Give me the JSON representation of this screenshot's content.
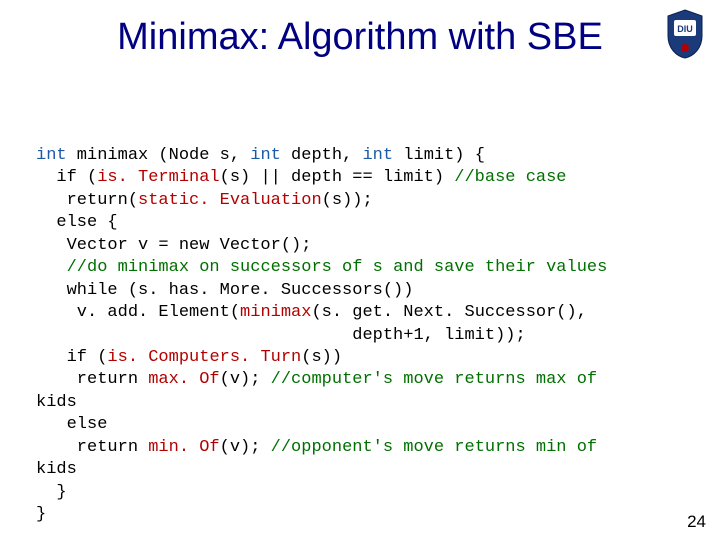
{
  "title": "Minimax: Algorithm with SBE",
  "logo": {
    "name": "diu-crest"
  },
  "code": {
    "l1a": "int",
    "l1b": " minimax (Node s, ",
    "l1c": "int",
    "l1d": " depth, ",
    "l1e": "int",
    "l1f": " limit) {",
    "l2a": "  if (",
    "l2b": "is. Terminal",
    "l2c": "(s) || depth == limit) ",
    "l2d": "//base case",
    "l3a": "   return(",
    "l3b": "static. Evaluation",
    "l3c": "(s));",
    "l4": "  else {",
    "l5": "   Vector v = new Vector();",
    "l6": "   ",
    "l6b": "//do minimax on successors of s and save their values",
    "l7": "   while (s. has. More. Successors())",
    "l8a": "    v. add. Element(",
    "l8b": "minimax",
    "l8c": "(s. get. Next. Successor(),",
    "l9": "                               depth+1, limit));",
    "l10a": "   if (",
    "l10b": "is. Computers. Turn",
    "l10c": "(s))",
    "l11a": "    return ",
    "l11b": "max. Of",
    "l11c": "(v); ",
    "l11d": "//computer's move returns max of",
    "l12": "kids",
    "l13": "   else",
    "l14a": "    return ",
    "l14b": "min. Of",
    "l14c": "(v); ",
    "l14d": "//opponent's move returns min of",
    "l15": "kids",
    "l16": "  }",
    "l17": "}"
  },
  "page_number": "24"
}
